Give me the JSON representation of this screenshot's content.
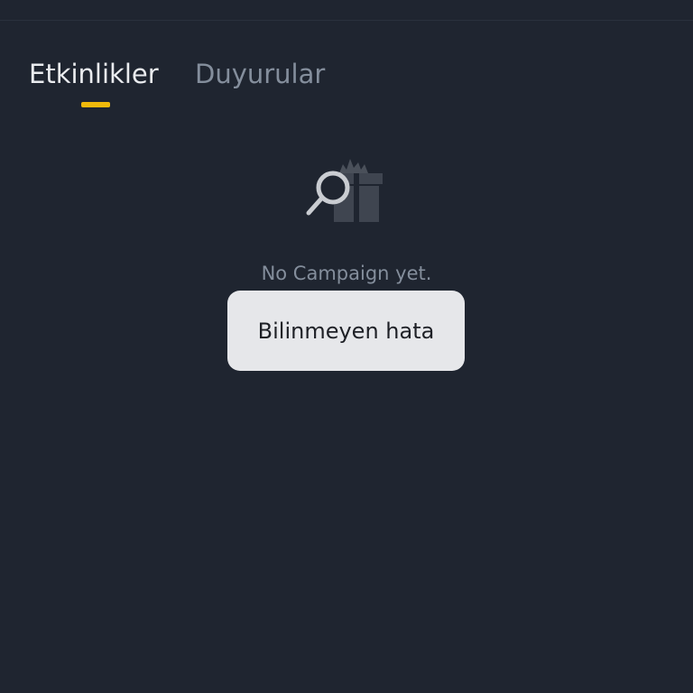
{
  "tabs": {
    "items": [
      {
        "label": "Etkinlikler",
        "active": true
      },
      {
        "label": "Duyurular",
        "active": false
      }
    ]
  },
  "empty_state": {
    "icon": "gift-search-icon",
    "message": "No Campaign yet."
  },
  "toast": {
    "message": "Bilinmeyen hata"
  },
  "colors": {
    "background": "#1f2530",
    "accent": "#f0b90b",
    "active_text": "#eaecef",
    "inactive_text": "#848e9c",
    "toast_background": "#e6e7ea"
  }
}
